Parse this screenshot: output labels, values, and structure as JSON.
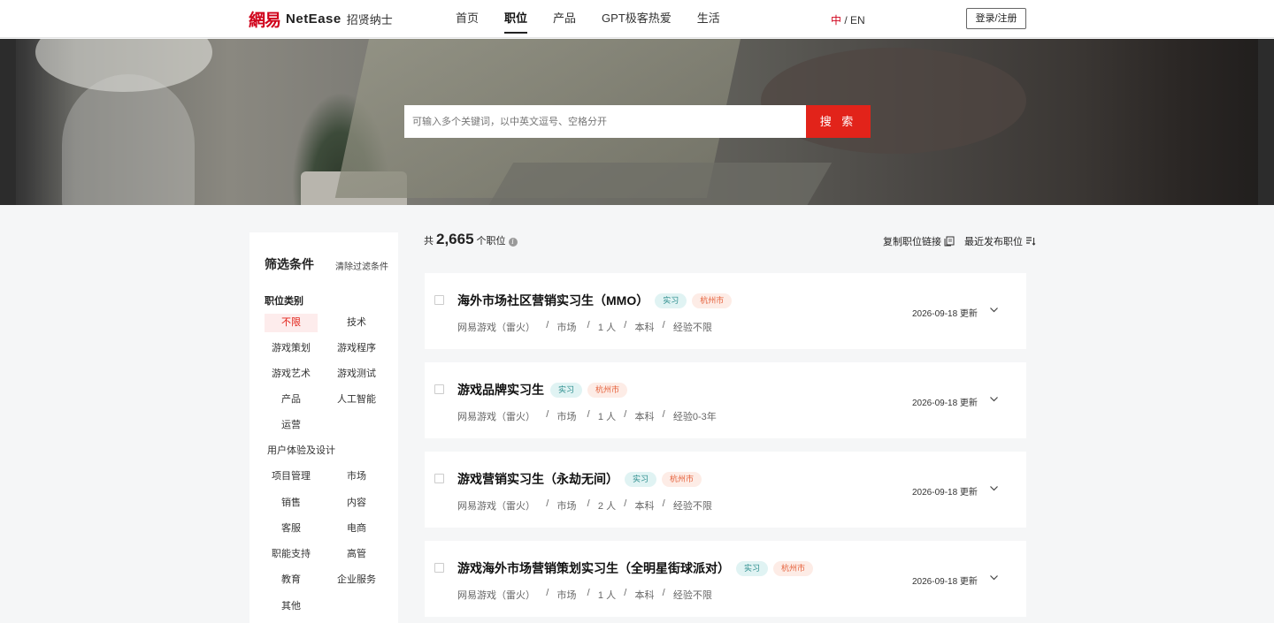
{
  "header": {
    "logo_cn": "網易",
    "logo_en": "NetEase",
    "logo_sub": "招贤纳士",
    "nav": [
      "首页",
      "职位",
      "产品",
      "GPT极客热爱",
      "生活"
    ],
    "active_nav": "职位",
    "lang_zh": "中",
    "lang_sep": " / ",
    "lang_en": "EN",
    "login": "登录/注册"
  },
  "search": {
    "placeholder": "可输入多个关键词，以中英文逗号、空格分开",
    "button": "搜 索"
  },
  "filter": {
    "title": "筛选条件",
    "clear": "清除过滤条件",
    "category_title": "职位类别",
    "categories": [
      "不限",
      "技术",
      "游戏策划",
      "游戏程序",
      "游戏艺术",
      "游戏测试",
      "产品",
      "人工智能",
      "运营",
      "用户体验及设计",
      "项目管理",
      "市场",
      "销售",
      "内容",
      "客服",
      "电商",
      "职能支持",
      "高管",
      "教育",
      "企业服务",
      "其他"
    ],
    "selected": "不限"
  },
  "results": {
    "count_prefix": "共",
    "count": "2,665",
    "count_suffix": "个职位",
    "copy_link": "复制职位链接",
    "sort": "最近发布职位"
  },
  "jobs": [
    {
      "title": "海外市场社区营销实习生（MMO）",
      "type": "实习",
      "city": "杭州市",
      "company": "网易游戏（雷火）",
      "category": "市场",
      "headcount": "1 人",
      "education": "本科",
      "experience": "经验不限",
      "date": "2026-09-18 更新"
    },
    {
      "title": "游戏品牌实习生",
      "type": "实习",
      "city": "杭州市",
      "company": "网易游戏（雷火）",
      "category": "市场",
      "headcount": "1 人",
      "education": "本科",
      "experience": "经验0-3年",
      "date": "2026-09-18 更新"
    },
    {
      "title": "游戏营销实习生（永劫无间）",
      "type": "实习",
      "city": "杭州市",
      "company": "网易游戏（雷火）",
      "category": "市场",
      "headcount": "2 人",
      "education": "本科",
      "experience": "经验不限",
      "date": "2026-09-18 更新"
    },
    {
      "title": "游戏海外市场营销策划实习生（全明星街球派对）",
      "type": "实习",
      "city": "杭州市",
      "company": "网易游戏（雷火）",
      "category": "市场",
      "headcount": "1 人",
      "education": "本科",
      "experience": "经验不限",
      "date": "2026-09-18 更新"
    }
  ],
  "colors": {
    "brand_red": "#e2231a",
    "intern_tag_bg": "#e0f3f3",
    "city_tag_bg": "#fdece6"
  }
}
